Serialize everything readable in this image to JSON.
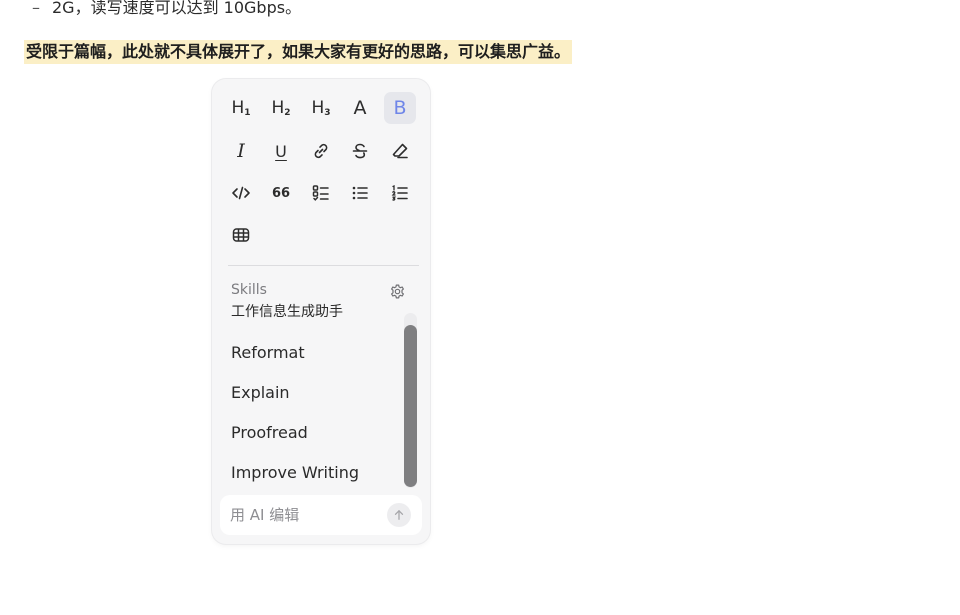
{
  "document": {
    "bullet_line": {
      "dash": "–",
      "text": "2G，读写速度可以达到 10Gbps。"
    },
    "highlight_line": "受限于篇幅，此处就不具体展开了，如果大家有更好的思路，可以集思广益。"
  },
  "toolbar": {
    "h1": {
      "letter": "H",
      "sub": "1"
    },
    "h2": {
      "letter": "H",
      "sub": "2"
    },
    "h3": {
      "letter": "H",
      "sub": "3"
    },
    "text_style": "A",
    "bold": "B",
    "italic": "I",
    "underline": "U",
    "quote": "66",
    "active_color": "#6f86e8"
  },
  "skills": {
    "label": "Skills",
    "items": [
      {
        "label": "工作信息生成助手"
      },
      {
        "label": "Reformat"
      },
      {
        "label": "Explain"
      },
      {
        "label": "Proofread"
      },
      {
        "label": "Improve Writing"
      }
    ]
  },
  "ai_input": {
    "placeholder": "用 AI 编辑",
    "value": ""
  },
  "colors": {
    "highlight": "#fbefc6",
    "panel": "#f6f6f7",
    "icon": "#2d2d2d"
  }
}
